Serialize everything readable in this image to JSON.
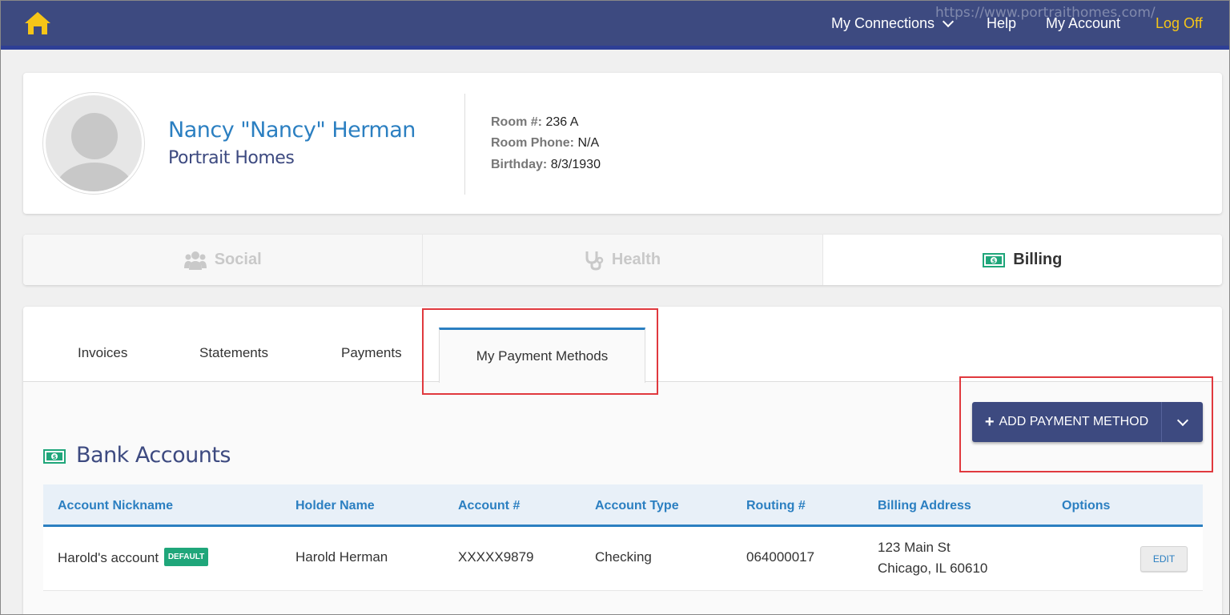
{
  "nav": {
    "url_overlay": "https://www.portraithomes.com/",
    "my_connections": "My Connections",
    "help": "Help",
    "my_account": "My Account",
    "log_off": "Log Off"
  },
  "profile": {
    "name": "Nancy \"Nancy\" Herman",
    "facility": "Portrait Homes",
    "room_label": "Room #:",
    "room_value": "236 A",
    "phone_label": "Room Phone:",
    "phone_value": "N/A",
    "birthday_label": "Birthday:",
    "birthday_value": "8/3/1930"
  },
  "section_tabs": {
    "social": "Social",
    "health": "Health",
    "billing": "Billing",
    "active": "Billing"
  },
  "billing_tabs": {
    "invoices": "Invoices",
    "statements": "Statements",
    "payments": "Payments",
    "my_payment_methods": "My Payment Methods",
    "active": "My Payment Methods"
  },
  "add_payment_button": {
    "label": "ADD PAYMENT METHOD",
    "icon": "plus-icon"
  },
  "bank_accounts": {
    "title": "Bank Accounts",
    "columns": [
      "Account Nickname",
      "Holder Name",
      "Account #",
      "Account Type",
      "Routing #",
      "Billing Address",
      "Options"
    ],
    "rows": [
      {
        "nickname": "Harold's account",
        "badge": "DEFAULT",
        "holder": "Harold Herman",
        "account": "XXXXX9879",
        "type": "Checking",
        "routing": "064000017",
        "address_line1": "123 Main St",
        "address_line2": "Chicago, IL 60610",
        "action": "EDIT"
      }
    ]
  },
  "colors": {
    "nav_bg": "#3d4a80",
    "accent_blue": "#2b7fc1",
    "log_off": "#f5c518",
    "default_badge": "#1fa67a",
    "highlight": "#e0393e"
  }
}
